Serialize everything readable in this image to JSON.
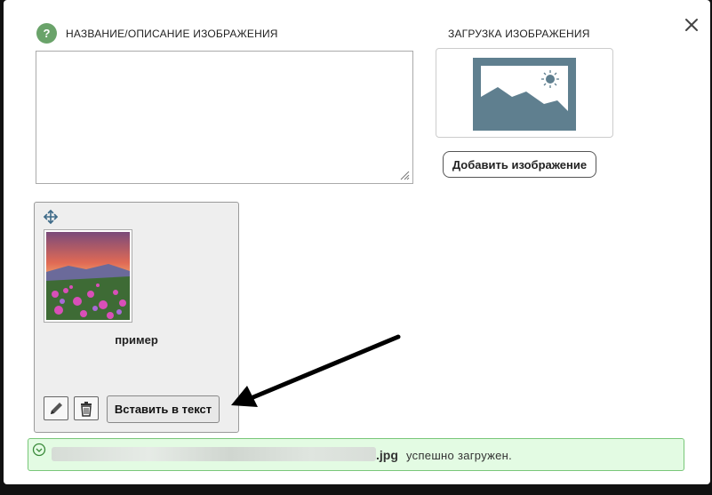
{
  "dialog": {
    "close_icon": "close-icon",
    "help_badge": "?",
    "description_label": "НАЗВАНИЕ/ОПИСАНИЕ ИЗОБРАЖЕНИЯ",
    "description_value": "",
    "upload_label": "ЗАГРУЗКА ИЗОБРАЖЕНИЯ",
    "upload_placeholder_icon": "image-placeholder-icon",
    "add_image_button": "Добавить изображение"
  },
  "image_card": {
    "caption": "пример",
    "edit_icon": "pencil-icon",
    "delete_icon": "trash-icon",
    "move_icon": "move-icon",
    "insert_button": "Вставить в текст"
  },
  "status": {
    "file_extension": ".jpg",
    "message": "успешно загружен.",
    "icon": "check-circle-icon",
    "colors": {
      "background": "#e3fbe3",
      "border": "#79c779"
    }
  },
  "colors": {
    "help_badge": "#6aa36a",
    "placeholder": "#5f7f8f"
  }
}
